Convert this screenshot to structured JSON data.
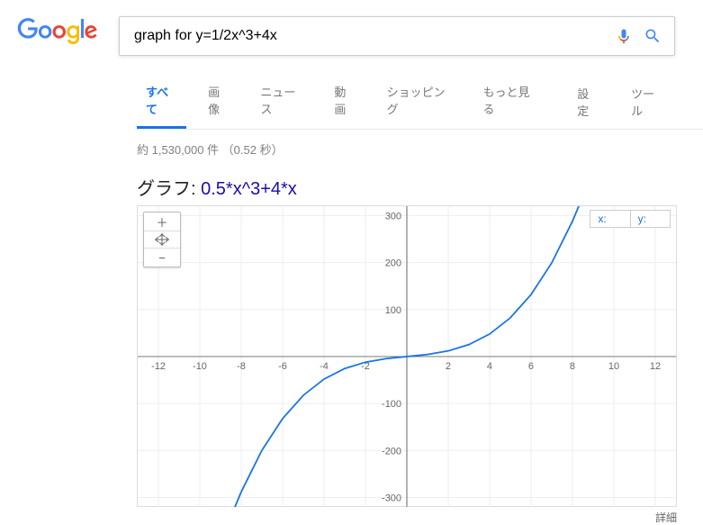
{
  "search": {
    "query": "graph for y=1/2x^3+4x"
  },
  "tabs": {
    "all": "すべて",
    "images": "画像",
    "news": "ニュース",
    "videos": "動画",
    "shopping": "ショッピング",
    "more": "もっと見る",
    "settings": "設定",
    "tools": "ツール"
  },
  "results_meta": "約 1,530,000 件 （0.52 秒）",
  "graph": {
    "title_prefix": "グラフ: ",
    "expression": "0.5*x^3+4*x",
    "x_label": "x:",
    "y_label": "y:",
    "zoom_plus": "＋",
    "zoom_minus": "−"
  },
  "details_link": "詳細",
  "chart_data": {
    "type": "line",
    "title": "0.5*x^3+4*x",
    "xlabel": "",
    "ylabel": "",
    "xlim": [
      -13,
      13
    ],
    "ylim": [
      -320,
      320
    ],
    "x_ticks": [
      -12,
      -10,
      -8,
      -6,
      -4,
      -2,
      2,
      4,
      6,
      8,
      10,
      12
    ],
    "y_ticks": [
      -300,
      -200,
      -100,
      100,
      200,
      300
    ],
    "series": [
      {
        "name": "0.5*x^3+4*x",
        "color": "#1a73e8",
        "x": [
          -8.5,
          -8,
          -7,
          -6,
          -5,
          -4,
          -3,
          -2,
          -1,
          0,
          1,
          2,
          3,
          4,
          5,
          6,
          7,
          8,
          8.5
        ],
        "y": [
          -341.1,
          -288,
          -199.5,
          -132,
          -82.5,
          -48,
          -25.5,
          -12,
          -4.5,
          0,
          4.5,
          12,
          25.5,
          48,
          82.5,
          132,
          199.5,
          288,
          341.1
        ]
      }
    ]
  }
}
